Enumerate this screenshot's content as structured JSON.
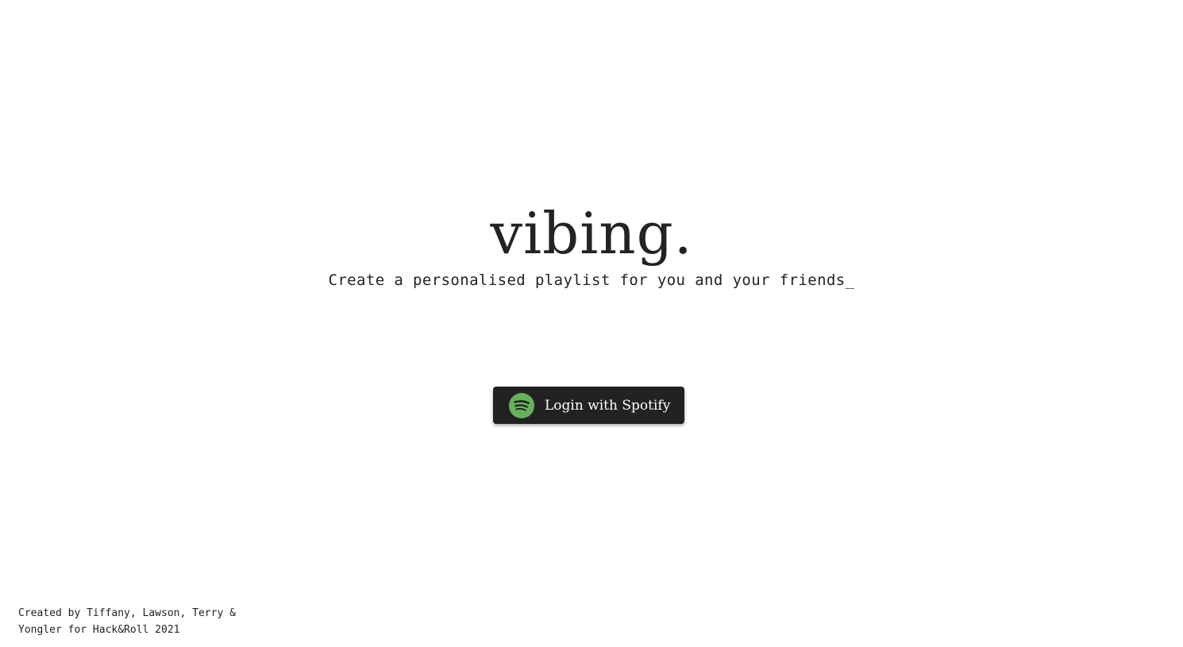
{
  "hero": {
    "title": "vibing.",
    "subtitle": "Create a personalised playlist for you and your friends_"
  },
  "login": {
    "label": "Login with Spotify",
    "icon": "spotify-icon",
    "icon_color": "#67b15c",
    "button_color": "#222222"
  },
  "footer": {
    "line1": "Created by Tiffany, Lawson, Terry &",
    "line2": "Yongler for Hack&Roll 2021"
  }
}
